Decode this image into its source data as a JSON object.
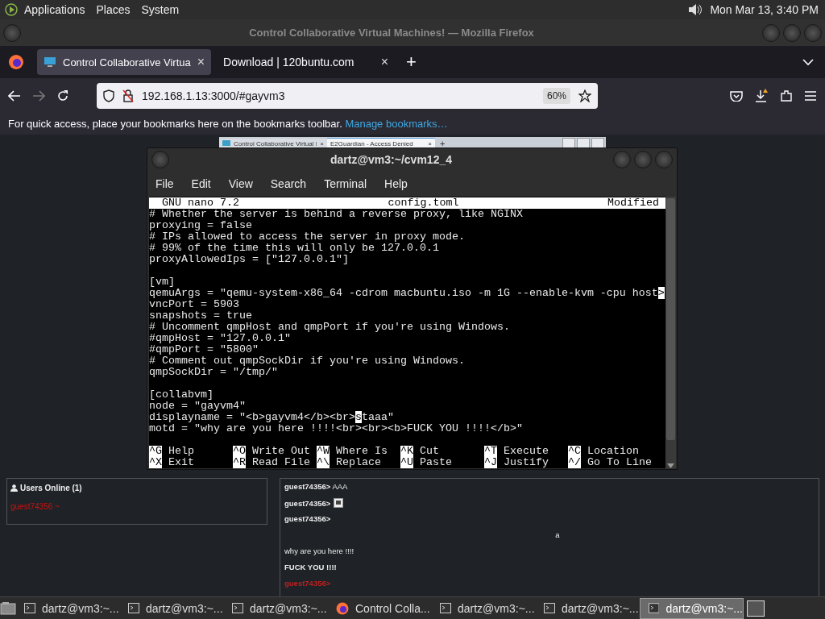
{
  "top_panel": {
    "menus": [
      "Applications",
      "Places",
      "System"
    ],
    "clock": "Mon Mar 13,  3:40 PM"
  },
  "browser": {
    "title": "Control Collaborative Virtual Machines! — Mozilla Firefox",
    "tabs": [
      {
        "label": "Control Collaborative Virtua",
        "selected": true,
        "close": "×"
      },
      {
        "label": "Download | 120buntu.com",
        "selected": false,
        "close": "×"
      }
    ],
    "new_tab": "+",
    "url": "192.168.1.13:3000/#gayvm3",
    "zoom": "60%",
    "bookmarks_hint": "For quick access, place your bookmarks here on the bookmarks toolbar.",
    "bookmarks_link": "Manage bookmarks…"
  },
  "vm_screen": {
    "tabs": [
      {
        "label": "Control Collaborative Virtual I",
        "selected": false,
        "close": "×"
      },
      {
        "label": "E2Guardian - Access Denied",
        "selected": true,
        "close": "×"
      }
    ],
    "new_tab": "+"
  },
  "terminal": {
    "title": "dartz@vm3:~/cvm12_4",
    "menu": [
      "File",
      "Edit",
      "View",
      "Search",
      "Terminal",
      "Help"
    ],
    "nano": {
      "version": "GNU nano 7.2",
      "file": "config.toml",
      "status": "Modified",
      "lines": [
        {
          "text": "# Whether the server is behind a reverse proxy, like NGINX"
        },
        {
          "text": "proxying = false"
        },
        {
          "text": "# IPs allowed to access the server in proxy mode."
        },
        {
          "text": "# 99% of the time this will only be 127.0.0.1"
        },
        {
          "text": "proxyAllowedIps = [\"127.0.0.1\"]"
        },
        {
          "kind": "blank"
        },
        {
          "text": "[vm]"
        },
        {
          "text": "qemuArgs = \"qemu-system-x86_64 -cdrom macbuntu.iso -m 1G --enable-kvm -cpu host",
          "more": ">"
        },
        {
          "text": "vncPort = 5903"
        },
        {
          "text": "snapshots = true"
        },
        {
          "text": "# Uncomment qmpHost and qmpPort if you're using Windows."
        },
        {
          "text": "#qmpHost = \"127.0.0.1\""
        },
        {
          "text": "#qmpPort = \"5800\""
        },
        {
          "text": "# Comment out qmpSockDir if you're using Windows."
        },
        {
          "text": "qmpSockDir = \"/tmp/\""
        },
        {
          "kind": "blank"
        },
        {
          "text": "[collabvm]"
        },
        {
          "text": "node = \"gayvm4\""
        },
        {
          "text": "displayname = \"<b>gayvm4</b><br>",
          "cursor": "s",
          "rest": "taaa\""
        },
        {
          "text": "motd = \"why are you here !!!!<br><br><b>FUCK YOU !!!!</b>\""
        }
      ],
      "shortcuts": [
        [
          {
            "key": "^G",
            "label": "Help"
          },
          {
            "key": "^O",
            "label": "Write Out"
          },
          {
            "key": "^W",
            "label": "Where Is"
          },
          {
            "key": "^K",
            "label": "Cut"
          },
          {
            "key": "^T",
            "label": "Execute"
          },
          {
            "key": "^C",
            "label": "Location"
          }
        ],
        [
          {
            "key": "^X",
            "label": "Exit"
          },
          {
            "key": "^R",
            "label": "Read File"
          },
          {
            "key": "^\\",
            "label": "Replace"
          },
          {
            "key": "^U",
            "label": "Paste"
          },
          {
            "key": "^J",
            "label": "Justify"
          },
          {
            "key": "^/",
            "label": "Go To Line"
          }
        ]
      ]
    }
  },
  "users_panel": {
    "title": "Users Online (1)",
    "users": [
      {
        "name": "guest74356 ~",
        "color": "#cc1111"
      }
    ]
  },
  "chat": [
    {
      "kind": "message",
      "text": "**guest74356>** AAA"
    },
    {
      "kind": "image",
      "user": "guest74356>"
    },
    {
      "kind": "user",
      "text": "guest74356>"
    },
    {
      "kind": "centered",
      "text": "a"
    },
    {
      "kind": "plain",
      "text": "why are you here !!!!"
    },
    {
      "kind": "bold",
      "text": "FUCK YOU !!!!"
    },
    {
      "kind": "user-red",
      "text": "guest74356>"
    }
  ],
  "taskbar": [
    {
      "label": "dartz@vm3:~...",
      "kind": "terminal",
      "selected": false
    },
    {
      "label": "dartz@vm3:~...",
      "kind": "terminal",
      "selected": false
    },
    {
      "label": "dartz@vm3:~...",
      "kind": "terminal",
      "selected": false
    },
    {
      "label": "Control Colla...",
      "kind": "browser",
      "selected": false
    },
    {
      "label": "dartz@vm3:~...",
      "kind": "terminal",
      "selected": false
    },
    {
      "label": "dartz@vm3:~...",
      "kind": "terminal",
      "selected": false
    },
    {
      "label": "dartz@vm3:~...",
      "kind": "terminal",
      "selected": true
    }
  ]
}
